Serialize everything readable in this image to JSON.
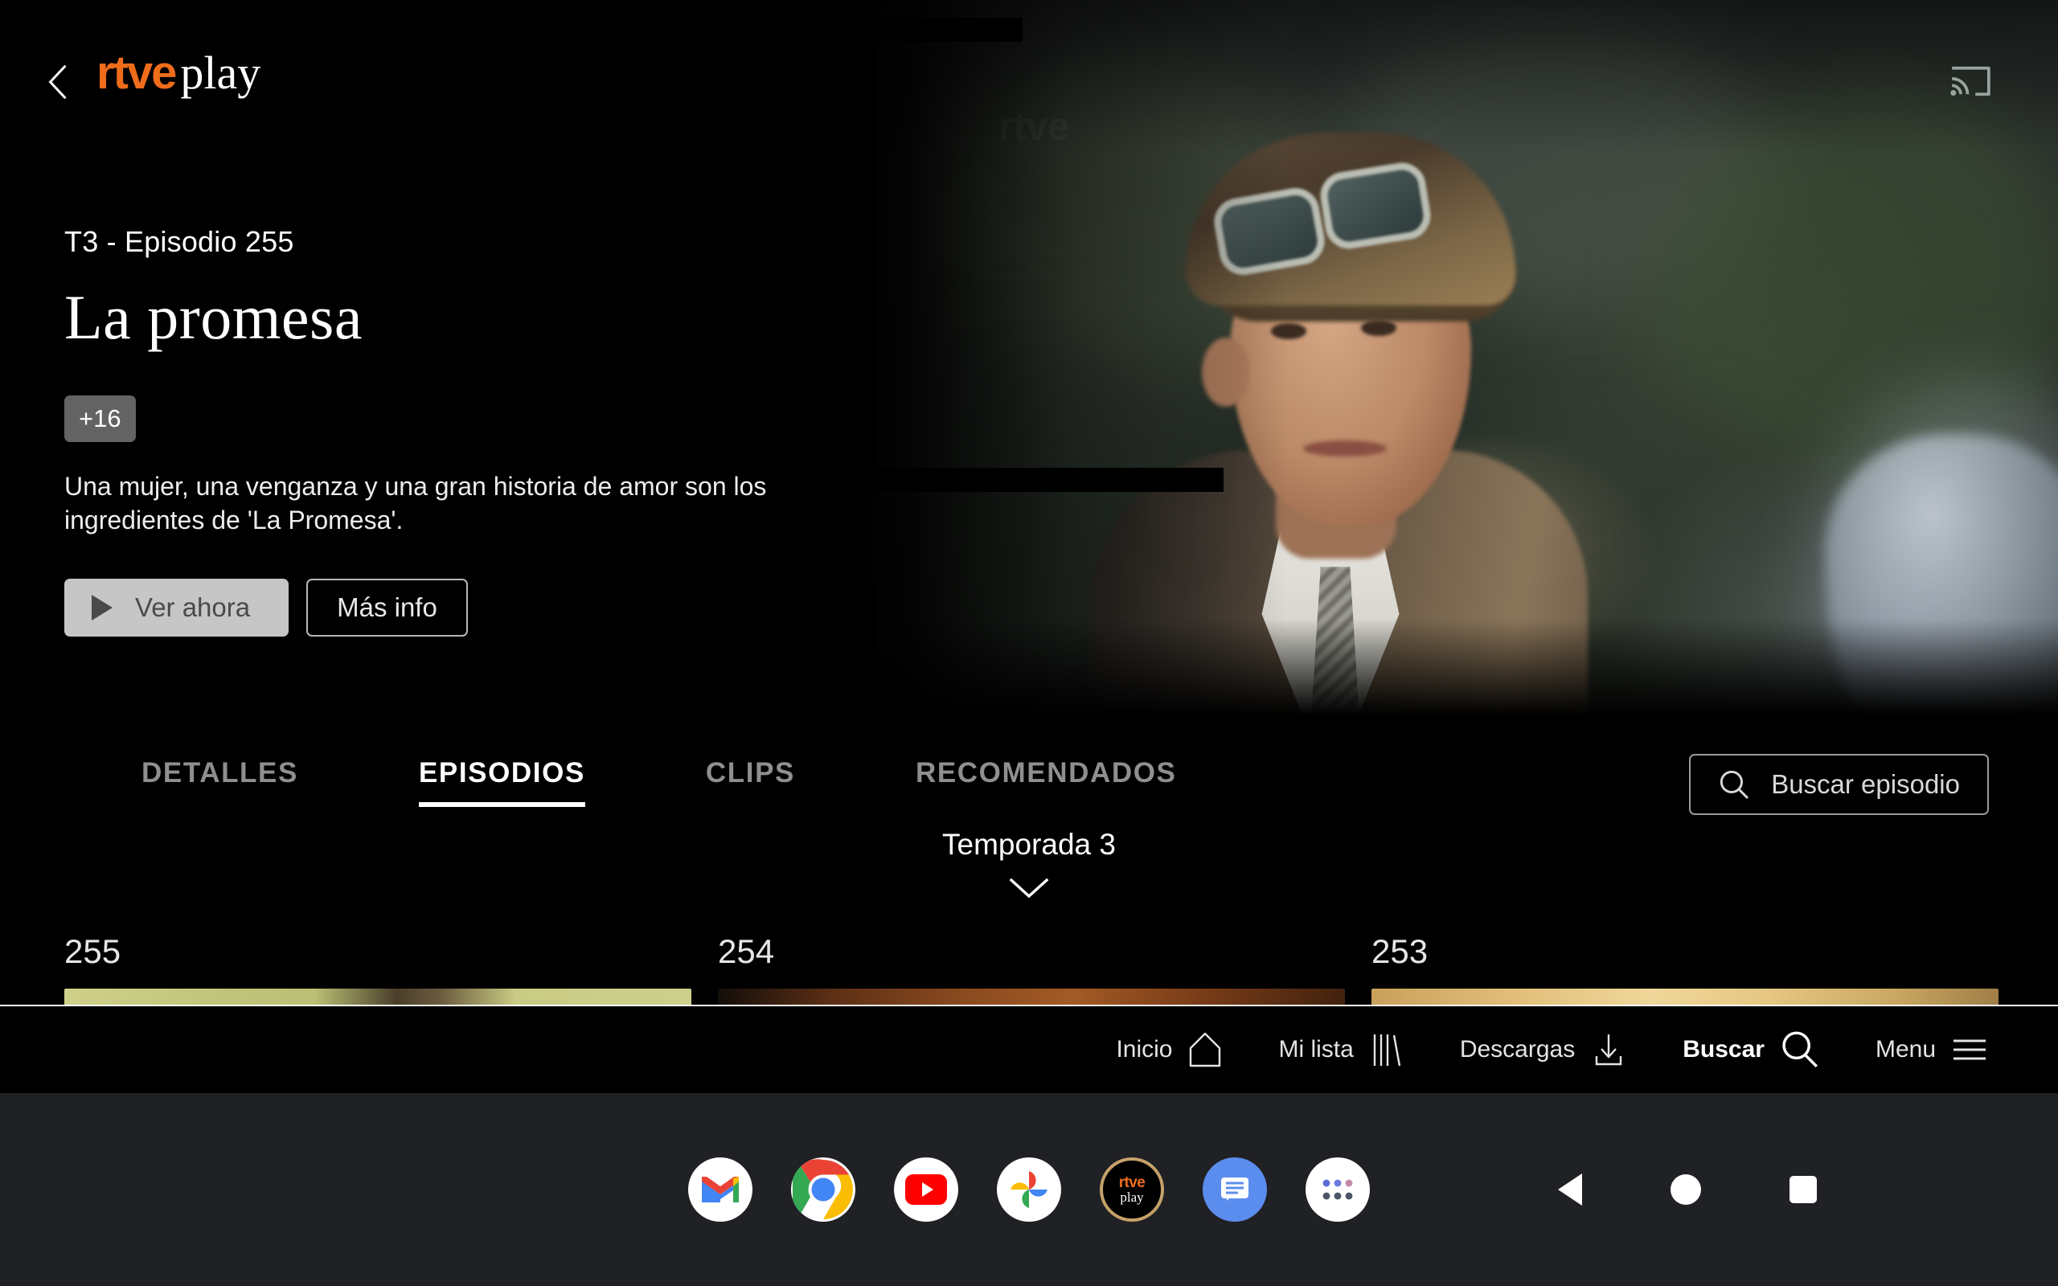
{
  "app": {
    "brand_primary": "rtve",
    "brand_secondary": "play",
    "brand_color": "#ef6c1a",
    "back_icon": "chevron-left-icon",
    "cast_icon": "cast-icon",
    "hero_watermark": "rtve"
  },
  "hero": {
    "episode_label": "T3 - Episodio 255",
    "title": "La promesa",
    "age_rating": "+16",
    "synopsis": "Una mujer, una venganza y una gran historia de amor son los ingredientes de 'La Promesa'.",
    "play_button": "Ver ahora",
    "info_button": "Más info"
  },
  "tabs": [
    {
      "label": "DETALLES",
      "active": false
    },
    {
      "label": "EPISODIOS",
      "active": true
    },
    {
      "label": "CLIPS",
      "active": false
    },
    {
      "label": "RECOMENDADOS",
      "active": false
    }
  ],
  "search_episode": {
    "label": "Buscar episodio",
    "icon": "search-icon"
  },
  "season": {
    "label": "Temporada 3",
    "chevron_icon": "chevron-down-icon"
  },
  "episodes": [
    {
      "number": "255",
      "thumb_class": "th-255"
    },
    {
      "number": "254",
      "thumb_class": "th-254"
    },
    {
      "number": "253",
      "thumb_class": "th-253"
    }
  ],
  "bottom_nav": [
    {
      "label": "Inicio",
      "icon": "home-icon",
      "active": false
    },
    {
      "label": "Mi lista",
      "icon": "bookshelf-icon",
      "active": false
    },
    {
      "label": "Descargas",
      "icon": "download-icon",
      "active": false
    },
    {
      "label": "Buscar",
      "icon": "search-icon",
      "active": true
    },
    {
      "label": "Menu",
      "icon": "hamburger-icon",
      "active": false
    }
  ],
  "dock": [
    {
      "name": "gmail"
    },
    {
      "name": "chrome"
    },
    {
      "name": "youtube"
    },
    {
      "name": "google-photos"
    },
    {
      "name": "rtve-play"
    },
    {
      "name": "messages"
    },
    {
      "name": "app-drawer"
    }
  ],
  "system_nav": [
    {
      "name": "back"
    },
    {
      "name": "home"
    },
    {
      "name": "recents"
    }
  ]
}
